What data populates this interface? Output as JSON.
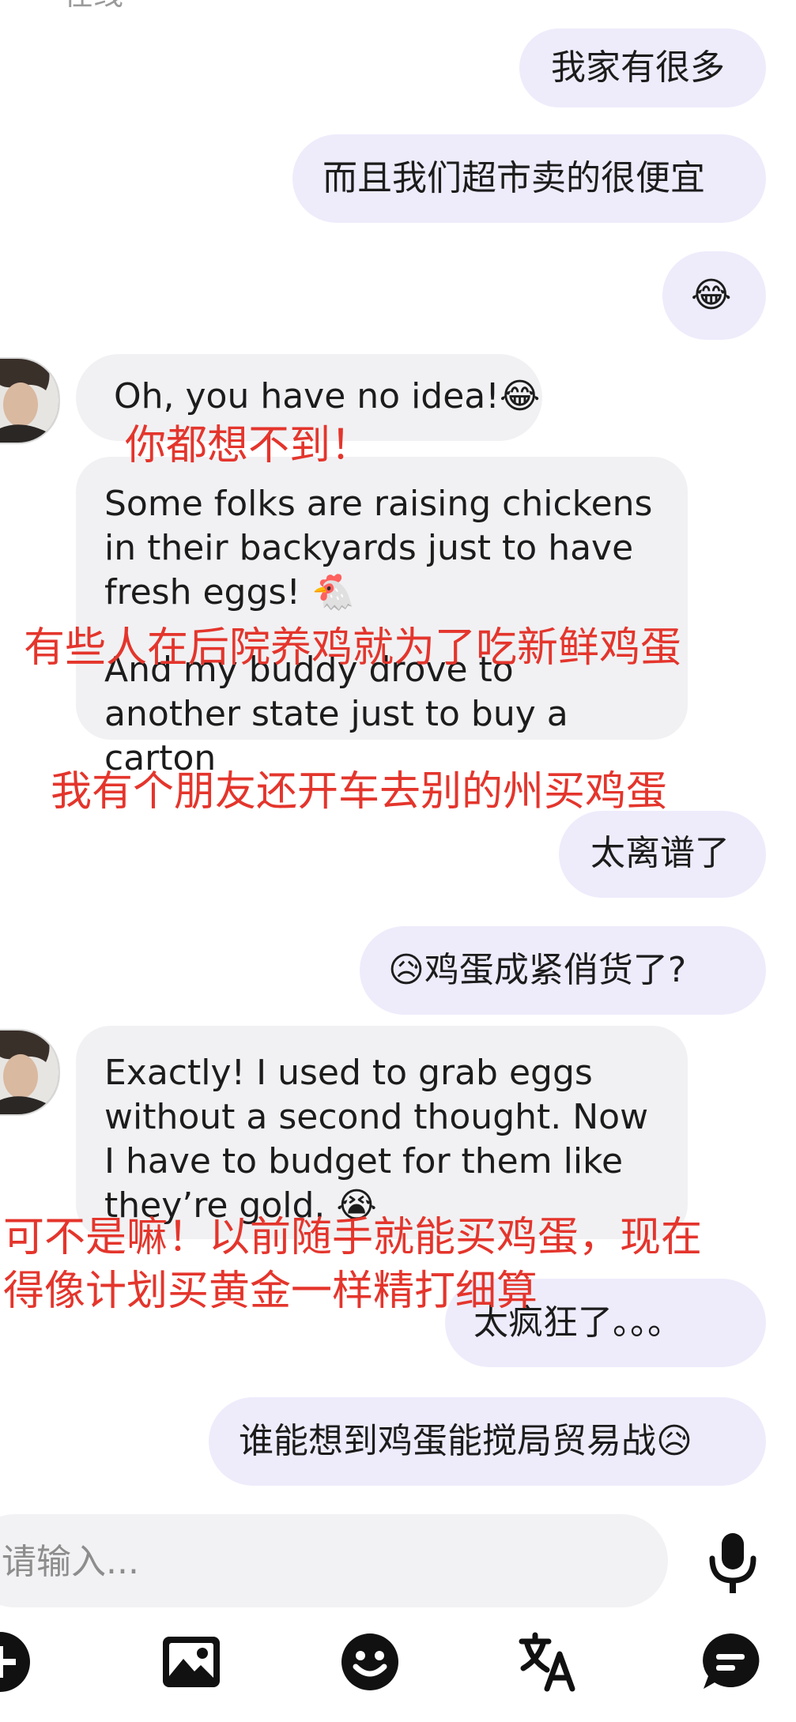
{
  "header": {
    "status_text": "在线"
  },
  "messages": [
    {
      "id": "m1",
      "side": "outgoing",
      "text": "我家有很多"
    },
    {
      "id": "m2",
      "side": "outgoing",
      "text": "而且我们超市卖的很便宜"
    },
    {
      "id": "m3",
      "side": "outgoing",
      "text": "😂"
    },
    {
      "id": "m4",
      "side": "incoming",
      "text": "Oh, you have no idea!😂"
    },
    {
      "id": "m5",
      "side": "incoming",
      "text": "Some folks are raising chickens in their backyards just to have fresh eggs! 🐔"
    },
    {
      "id": "m6",
      "side": "incoming",
      "text": "And my buddy drove to another state just to buy a carton"
    },
    {
      "id": "m7",
      "side": "outgoing",
      "text": "太离谱了"
    },
    {
      "id": "m8",
      "side": "outgoing",
      "text": "😥鸡蛋成紧俏货了?"
    },
    {
      "id": "m9",
      "side": "incoming",
      "text": "Exactly! I used to grab eggs without a second thought. Now I have to budget for them like they’re gold. 😭"
    },
    {
      "id": "m10",
      "side": "outgoing",
      "text": "太疯狂了。。。"
    },
    {
      "id": "m11",
      "side": "outgoing",
      "text": "谁能想到鸡蛋能搅局贸易战😥"
    }
  ],
  "translations": {
    "t1": "你都想不到！",
    "t2": "有些人在后院养鸡就为了吃新鲜鸡蛋",
    "t3": "我有个朋友还开车去别的州买鸡蛋",
    "t4_line1": "可不是嘛！以前随手就能买鸡蛋，现在",
    "t4_line2": "得像计划买黄金一样精打细算"
  },
  "composer": {
    "placeholder": "请输入...",
    "value": ""
  },
  "toolbar": {
    "icons": [
      "add-icon",
      "image-icon",
      "emoji-icon",
      "translate-icon",
      "quick-reply-icon"
    ]
  },
  "colors": {
    "outgoing_bubble": "#eeecfb",
    "incoming_bubble": "#f1f1f3",
    "translation_text": "#e4352c",
    "icon": "#111111"
  }
}
